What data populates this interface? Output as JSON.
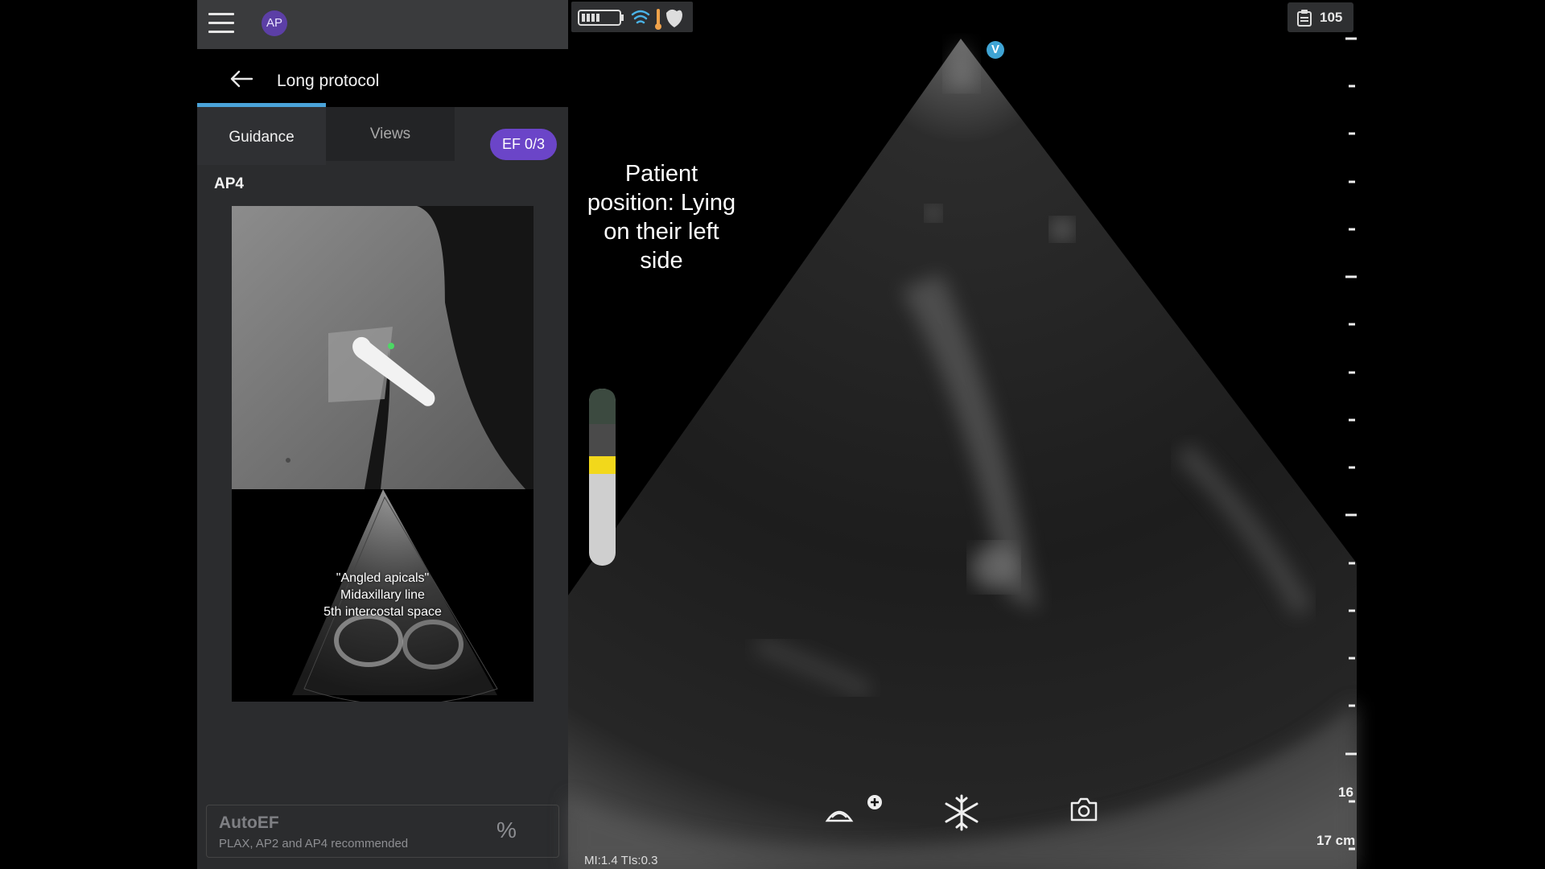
{
  "app": {
    "avatar_initials": "AP",
    "accent_color": "#6b45c8"
  },
  "header": {
    "title": "Long protocol"
  },
  "tabs": [
    {
      "label": "Guidance",
      "selected": true
    },
    {
      "label": "Views",
      "selected": false
    }
  ],
  "ef_badge": "EF 0/3",
  "guidance": {
    "view_name": "AP4",
    "caption_lines": [
      "\"Angled apicals\"",
      "Midaxillary line",
      "5th intercostal space"
    ]
  },
  "autoef": {
    "title": "AutoEF",
    "subtitle": "PLAX, AP2 and AP4 recommended",
    "unit": "%"
  },
  "status": {
    "icons": [
      "battery-icon",
      "wifi-icon",
      "temperature-icon",
      "heart-probe-icon"
    ],
    "counter_icon": "clipboard-icon",
    "counter": "105"
  },
  "scan": {
    "instruction": "Patient position: Lying on their left side",
    "marker": "V",
    "mi_ti": "MI:1.4  TIs:0.3",
    "depth_scale_value": "16",
    "depth": "17 cm",
    "controls": [
      "probe-add-icon",
      "freeze-icon",
      "camera-icon"
    ]
  }
}
